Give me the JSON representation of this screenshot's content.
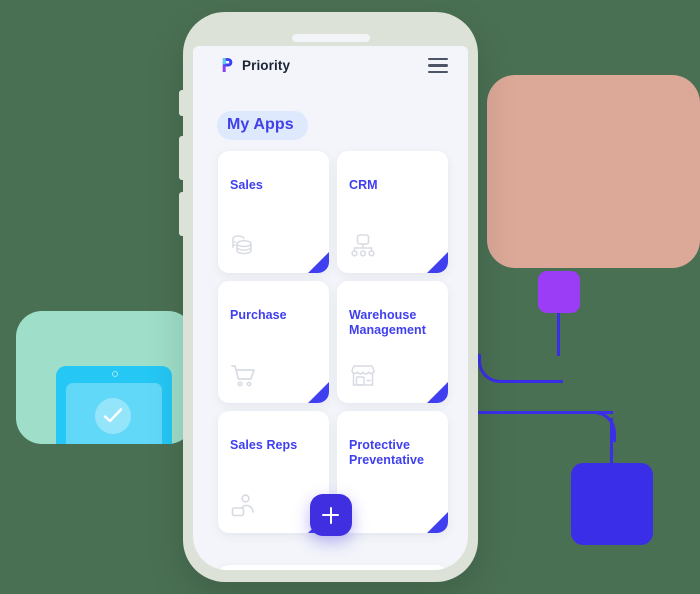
{
  "background": {
    "color": "#4a7053",
    "shapes": [
      {
        "name": "salmon-block",
        "color": "#dca898"
      },
      {
        "name": "mint-block",
        "color": "#9fdfc9"
      },
      {
        "name": "cyan-device",
        "color": "#25c7f4"
      },
      {
        "name": "purple-square",
        "color": "#9b3df7"
      },
      {
        "name": "blue-square",
        "color": "#3b2ee8"
      },
      {
        "name": "connector-wire",
        "color": "#3b2ee8"
      }
    ]
  },
  "phone": {
    "frame_color": "#dde2d8",
    "screen_color": "#f3f5fa"
  },
  "app": {
    "header": {
      "brand_name": "Priority",
      "logo_icon": "priority-p-logo-icon",
      "menu_icon": "hamburger-menu-icon"
    },
    "section_label": "My Apps",
    "section_label_color": "#4040e8",
    "section_label_bg": "#dfe9fd",
    "accent_color": "#3f3ff0",
    "cards": [
      {
        "title": "Sales",
        "icon": "database-stack-icon"
      },
      {
        "title": "CRM",
        "icon": "org-chart-icon"
      },
      {
        "title": "Purchase",
        "icon": "shopping-cart-icon"
      },
      {
        "title": "Warehouse\nManagement",
        "icon": "storefront-icon"
      },
      {
        "title": "Sales Reps",
        "icon": "person-laptop-icon"
      },
      {
        "title": "Protective\nPreventative",
        "icon": ""
      }
    ],
    "fab": {
      "label": "+",
      "icon": "plus-icon",
      "color": "#3f2fe0"
    }
  }
}
